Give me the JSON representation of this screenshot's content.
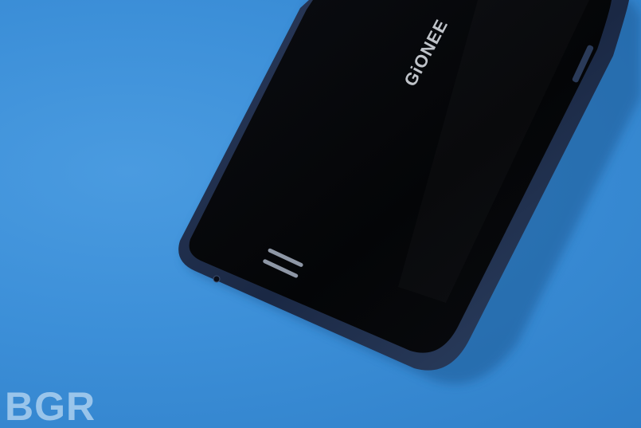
{
  "photo": {
    "subject": "smartphone-back",
    "background_color": "#3c8fd8",
    "phone_body_color": "#050608",
    "phone_frame_color": "#1e2d48",
    "brand_logo_text": "GiONEE",
    "watermark_text": "BGR"
  }
}
